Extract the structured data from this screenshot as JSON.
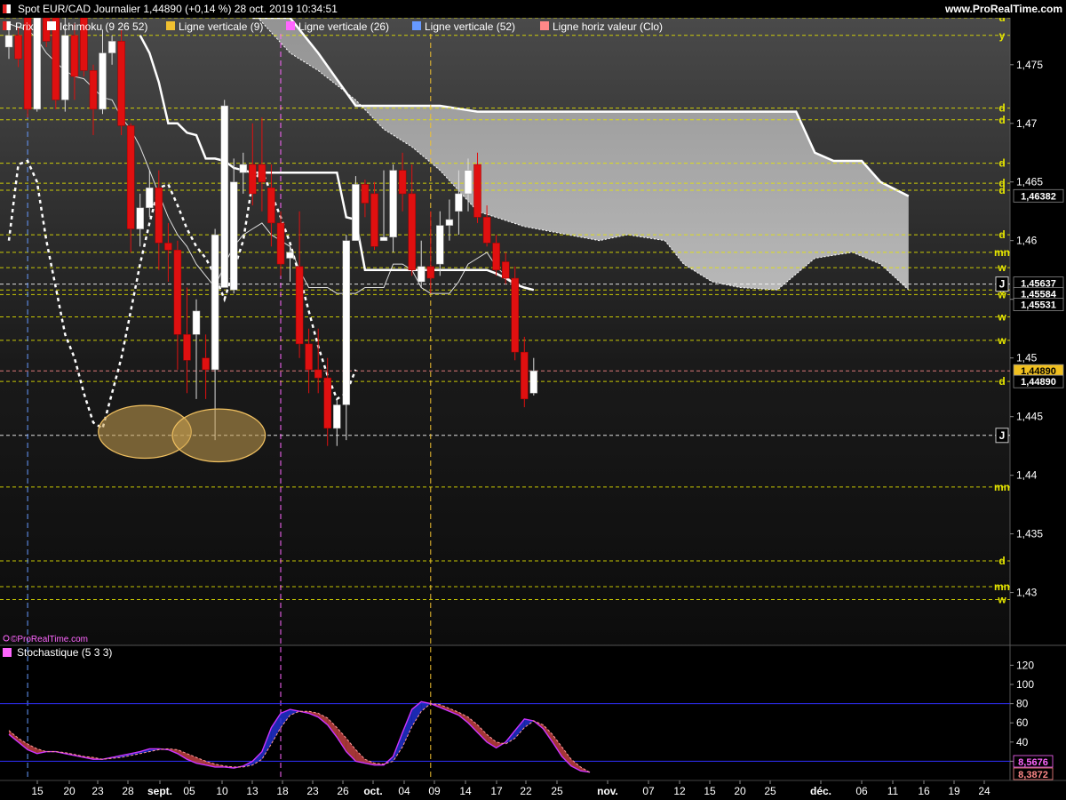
{
  "header": {
    "title": "Spot EUR/CAD Journalier 1,44890 (+0,14 %) 28 oct. 2019 10:34:51",
    "brand": "www.ProRealTime.com"
  },
  "legend": [
    {
      "label": "Prix",
      "color": "#ffffff"
    },
    {
      "label": "Ichimoku (9 26 52)",
      "color": "#ffffff"
    },
    {
      "label": "Ligne verticale (9)",
      "color": "#f0c030"
    },
    {
      "label": "Ligne verticale (26)",
      "color": "#ff66ff"
    },
    {
      "label": "Ligne verticale (52)",
      "color": "#6699ff"
    },
    {
      "label": "Ligne horiz valeur (Clo)",
      "color": "#ff8888"
    }
  ],
  "watermark": "©ProRealTime.com",
  "indicator": {
    "title": "Stochastique (5 3 3)",
    "ticks": [
      120,
      100,
      80,
      60,
      40,
      20
    ],
    "levels": [
      80,
      20
    ],
    "badge_k": "8,5676",
    "badge_d": "8,3872",
    "badge_k_color": "#ff66ff",
    "badge_d_color": "#ff8888"
  },
  "price_axis": {
    "ticks": [
      "1,475",
      "1,47",
      "1,465",
      "1,46",
      "1,455",
      "1,45",
      "1,445",
      "1,44",
      "1,435",
      "1,43"
    ],
    "badges": [
      {
        "text": "1,46382",
        "price": 1.46382,
        "bg": "#000000",
        "fg": "#ffffff"
      },
      {
        "text": "1,45637",
        "price": 1.45637,
        "bg": "#000000",
        "fg": "#ffffff"
      },
      {
        "text": "1,45584",
        "price": 1.45584,
        "bg": "#000000",
        "fg": "#ffffff"
      },
      {
        "text": "1,45531",
        "price": 1.45531,
        "bg": "#000000",
        "fg": "#ffffff"
      },
      {
        "text": "1,44890",
        "price": 1.4489,
        "bg": "#f0c020",
        "fg": "#000000"
      },
      {
        "text": "1,44890",
        "price": 1.4489,
        "bg": "#000000",
        "fg": "#ffffff"
      }
    ]
  },
  "x_axis_labels": [
    "15",
    "20",
    "23",
    "28",
    "sept.",
    "05",
    "10",
    "13",
    "18",
    "23",
    "26",
    "oct.",
    "04",
    "09",
    "14",
    "17",
    "22",
    "25",
    "nov.",
    "07",
    "12",
    "15",
    "20",
    "25",
    "déc.",
    "06",
    "11",
    "16",
    "19",
    "24"
  ],
  "chart_data": [
    {
      "type": "candlestick",
      "title": "Spot EUR/CAD Journalier",
      "ylim": [
        1.4255,
        1.479
      ],
      "candles": [
        {
          "o": 1.4765,
          "h": 1.4785,
          "l": 1.4755,
          "c": 1.4775
        },
        {
          "o": 1.4775,
          "h": 1.4782,
          "l": 1.4748,
          "c": 1.4755
        },
        {
          "o": 1.4795,
          "h": 1.48,
          "l": 1.4705,
          "c": 1.4712
        },
        {
          "o": 1.4712,
          "h": 1.479,
          "l": 1.471,
          "c": 1.479
        },
        {
          "o": 1.479,
          "h": 1.4795,
          "l": 1.4765,
          "c": 1.477
        },
        {
          "o": 1.479,
          "h": 1.4795,
          "l": 1.4712,
          "c": 1.472
        },
        {
          "o": 1.472,
          "h": 1.479,
          "l": 1.471,
          "c": 1.4775
        },
        {
          "o": 1.4775,
          "h": 1.4785,
          "l": 1.472,
          "c": 1.474
        },
        {
          "o": 1.4795,
          "h": 1.48,
          "l": 1.474,
          "c": 1.4745
        },
        {
          "o": 1.4745,
          "h": 1.475,
          "l": 1.469,
          "c": 1.4712
        },
        {
          "o": 1.4712,
          "h": 1.478,
          "l": 1.4708,
          "c": 1.476
        },
        {
          "o": 1.476,
          "h": 1.4775,
          "l": 1.475,
          "c": 1.477
        },
        {
          "o": 1.477,
          "h": 1.478,
          "l": 1.469,
          "c": 1.4698
        },
        {
          "o": 1.4698,
          "h": 1.47,
          "l": 1.459,
          "c": 1.461
        },
        {
          "o": 1.461,
          "h": 1.464,
          "l": 1.4595,
          "c": 1.4628
        },
        {
          "o": 1.4628,
          "h": 1.466,
          "l": 1.462,
          "c": 1.4645
        },
        {
          "o": 1.4645,
          "h": 1.466,
          "l": 1.4575,
          "c": 1.4598
        },
        {
          "o": 1.4598,
          "h": 1.4615,
          "l": 1.4565,
          "c": 1.4592
        },
        {
          "o": 1.4592,
          "h": 1.46,
          "l": 1.449,
          "c": 1.452
        },
        {
          "o": 1.452,
          "h": 1.456,
          "l": 1.447,
          "c": 1.4498
        },
        {
          "o": 1.452,
          "h": 1.455,
          "l": 1.4465,
          "c": 1.454
        },
        {
          "o": 1.45,
          "h": 1.452,
          "l": 1.4465,
          "c": 1.449
        },
        {
          "o": 1.449,
          "h": 1.461,
          "l": 1.443,
          "c": 1.4605
        },
        {
          "o": 1.456,
          "h": 1.472,
          "l": 1.456,
          "c": 1.4715
        },
        {
          "o": 1.4558,
          "h": 1.467,
          "l": 1.4555,
          "c": 1.465
        },
        {
          "o": 1.4658,
          "h": 1.4675,
          "l": 1.464,
          "c": 1.4665
        },
        {
          "o": 1.4665,
          "h": 1.47,
          "l": 1.463,
          "c": 1.464
        },
        {
          "o": 1.4665,
          "h": 1.4705,
          "l": 1.4625,
          "c": 1.465
        },
        {
          "o": 1.4645,
          "h": 1.4665,
          "l": 1.4595,
          "c": 1.4615
        },
        {
          "o": 1.4615,
          "h": 1.4625,
          "l": 1.457,
          "c": 1.458
        },
        {
          "o": 1.4585,
          "h": 1.4595,
          "l": 1.4565,
          "c": 1.459
        },
        {
          "o": 1.4578,
          "h": 1.4625,
          "l": 1.45,
          "c": 1.4512
        },
        {
          "o": 1.4512,
          "h": 1.4525,
          "l": 1.447,
          "c": 1.449
        },
        {
          "o": 1.449,
          "h": 1.4525,
          "l": 1.447,
          "c": 1.4483
        },
        {
          "o": 1.4483,
          "h": 1.45,
          "l": 1.4425,
          "c": 1.444
        },
        {
          "o": 1.444,
          "h": 1.4465,
          "l": 1.4425,
          "c": 1.446
        },
        {
          "o": 1.446,
          "h": 1.4605,
          "l": 1.443,
          "c": 1.46
        },
        {
          "o": 1.46,
          "h": 1.4655,
          "l": 1.46,
          "c": 1.4648
        },
        {
          "o": 1.4648,
          "h": 1.4652,
          "l": 1.462,
          "c": 1.4632
        },
        {
          "o": 1.464,
          "h": 1.465,
          "l": 1.4592,
          "c": 1.4595
        },
        {
          "o": 1.46,
          "h": 1.466,
          "l": 1.46,
          "c": 1.4603
        },
        {
          "o": 1.4603,
          "h": 1.4665,
          "l": 1.459,
          "c": 1.466
        },
        {
          "o": 1.466,
          "h": 1.4675,
          "l": 1.4625,
          "c": 1.464
        },
        {
          "o": 1.464,
          "h": 1.4665,
          "l": 1.457,
          "c": 1.4575
        },
        {
          "o": 1.4565,
          "h": 1.46,
          "l": 1.456,
          "c": 1.4578
        },
        {
          "o": 1.4578,
          "h": 1.4625,
          "l": 1.4555,
          "c": 1.4568
        },
        {
          "o": 1.458,
          "h": 1.4625,
          "l": 1.457,
          "c": 1.4613
        },
        {
          "o": 1.4613,
          "h": 1.4635,
          "l": 1.46,
          "c": 1.4618
        },
        {
          "o": 1.4625,
          "h": 1.466,
          "l": 1.4605,
          "c": 1.464
        },
        {
          "o": 1.464,
          "h": 1.467,
          "l": 1.4625,
          "c": 1.466
        },
        {
          "o": 1.4665,
          "h": 1.4675,
          "l": 1.4615,
          "c": 1.462
        },
        {
          "o": 1.462,
          "h": 1.463,
          "l": 1.4595,
          "c": 1.4598
        },
        {
          "o": 1.4598,
          "h": 1.4605,
          "l": 1.457,
          "c": 1.4575
        },
        {
          "o": 1.4582,
          "h": 1.459,
          "l": 1.4563,
          "c": 1.4568
        },
        {
          "o": 1.4568,
          "h": 1.4578,
          "l": 1.4498,
          "c": 1.4505
        },
        {
          "o": 1.4505,
          "h": 1.4518,
          "l": 1.4458,
          "c": 1.4465
        },
        {
          "o": 1.447,
          "h": 1.45,
          "l": 1.4468,
          "c": 1.4489
        }
      ],
      "tenkan": [
        1.4785,
        1.4782,
        1.478,
        1.4772,
        1.476,
        1.4752,
        1.4745,
        1.474,
        1.4738,
        1.473,
        1.4722,
        1.472,
        1.4705,
        1.4695,
        1.468,
        1.466,
        1.464,
        1.462,
        1.4605,
        1.4595,
        1.458,
        1.457,
        1.456,
        1.458,
        1.4595,
        1.4605,
        1.461,
        1.4615,
        1.4605,
        1.46,
        1.4595,
        1.4575,
        1.456,
        1.456,
        1.456,
        1.4555,
        1.4555,
        1.4555,
        1.456,
        1.456,
        1.456,
        1.458,
        1.458,
        1.4575,
        1.456,
        1.4555,
        1.4555,
        1.4555,
        1.4565,
        1.458,
        1.4585,
        1.459,
        1.4578,
        1.457,
        1.4563,
        1.456,
        1.4558
      ],
      "kijun": [
        null,
        null,
        null,
        null,
        null,
        null,
        null,
        null,
        null,
        null,
        null,
        null,
        null,
        null,
        1.4775,
        1.476,
        1.4735,
        1.47,
        1.47,
        1.4692,
        1.469,
        1.467,
        1.467,
        1.4668,
        1.4662,
        1.466,
        1.4658,
        1.4658,
        1.4658,
        1.4658,
        1.4658,
        1.4658,
        1.4658,
        1.4658,
        1.4658,
        1.4658,
        1.462,
        1.4618,
        1.4575,
        1.4575,
        1.4575,
        1.4575,
        1.4575,
        1.4575,
        1.4575,
        1.4575,
        1.4575,
        1.4575,
        1.4575,
        1.4575,
        1.4575,
        1.4575,
        1.4572,
        1.4568,
        1.4563,
        1.456,
        1.4558
      ],
      "chikou": [
        1.46,
        1.4665,
        1.4668,
        1.465,
        1.46,
        1.456,
        1.452,
        1.45,
        1.447,
        1.4445,
        1.444,
        1.447,
        1.45,
        1.454,
        1.458,
        1.4615,
        1.4645,
        1.4648,
        1.463,
        1.461,
        1.4595,
        1.4585,
        1.457,
        1.455,
        1.4575,
        1.46,
        1.465,
        1.466,
        1.464,
        1.462,
        1.4598,
        1.457,
        1.454,
        1.451,
        1.4485,
        1.4465,
        1.447,
        1.449
      ],
      "ssa": [
        {
          "i": 26,
          "v": 1.4795
        },
        {
          "i": 30,
          "v": 1.476
        },
        {
          "i": 33,
          "v": 1.4745
        },
        {
          "i": 37,
          "v": 1.472
        },
        {
          "i": 40,
          "v": 1.4695
        },
        {
          "i": 43,
          "v": 1.468
        },
        {
          "i": 46,
          "v": 1.466
        },
        {
          "i": 50,
          "v": 1.4625
        },
        {
          "i": 55,
          "v": 1.4612
        },
        {
          "i": 59,
          "v": 1.4606
        },
        {
          "i": 63,
          "v": 1.46
        },
        {
          "i": 66,
          "v": 1.4605
        },
        {
          "i": 70,
          "v": 1.46
        },
        {
          "i": 72,
          "v": 1.458
        },
        {
          "i": 75,
          "v": 1.4565
        },
        {
          "i": 78,
          "v": 1.456
        },
        {
          "i": 82,
          "v": 1.4558
        },
        {
          "i": 86,
          "v": 1.4585
        },
        {
          "i": 90,
          "v": 1.459
        },
        {
          "i": 93,
          "v": 1.458
        },
        {
          "i": 96,
          "v": 1.4558
        }
      ],
      "ssb": [
        {
          "i": 26,
          "v": 1.479
        },
        {
          "i": 30,
          "v": 1.479
        },
        {
          "i": 33,
          "v": 1.476
        },
        {
          "i": 37,
          "v": 1.4715
        },
        {
          "i": 40,
          "v": 1.4715
        },
        {
          "i": 43,
          "v": 1.4715
        },
        {
          "i": 46,
          "v": 1.4715
        },
        {
          "i": 50,
          "v": 1.471
        },
        {
          "i": 55,
          "v": 1.471
        },
        {
          "i": 59,
          "v": 1.471
        },
        {
          "i": 63,
          "v": 1.471
        },
        {
          "i": 66,
          "v": 1.471
        },
        {
          "i": 70,
          "v": 1.471
        },
        {
          "i": 73,
          "v": 1.471
        },
        {
          "i": 76,
          "v": 1.471
        },
        {
          "i": 80,
          "v": 1.471
        },
        {
          "i": 84,
          "v": 1.471
        },
        {
          "i": 86,
          "v": 1.4675
        },
        {
          "i": 88,
          "v": 1.4668
        },
        {
          "i": 91,
          "v": 1.4668
        },
        {
          "i": 93,
          "v": 1.465
        },
        {
          "i": 96,
          "v": 1.4638
        }
      ],
      "lagging_ichimoku_kumo_edge": [],
      "vlines": [
        {
          "i": 2,
          "color": "#6699ff"
        },
        {
          "i": 29,
          "color": "#ff66ff"
        },
        {
          "i": 45,
          "color": "#f0c030"
        }
      ],
      "hlines": [
        {
          "price": 1.479,
          "label": "d",
          "color": "#e6e600"
        },
        {
          "price": 1.4775,
          "label": "y",
          "color": "#e6e600"
        },
        {
          "price": 1.4713,
          "label": "d",
          "color": "#e6e600"
        },
        {
          "price": 1.4703,
          "label": "d",
          "color": "#e6e600"
        },
        {
          "price": 1.4666,
          "label": "d",
          "color": "#e6e600"
        },
        {
          "price": 1.4649,
          "label": "d",
          "color": "#e6e600"
        },
        {
          "price": 1.4643,
          "label": "d",
          "color": "#e6e600"
        },
        {
          "price": 1.4605,
          "label": "d",
          "color": "#e6e600"
        },
        {
          "price": 1.459,
          "label": "mn",
          "color": "#e6e600"
        },
        {
          "price": 1.4577,
          "label": "w",
          "color": "#e6e600"
        },
        {
          "price": 1.4563,
          "label": "",
          "color": "#ffffff"
        },
        {
          "price": 1.4558,
          "label": "k",
          "color": "#e6e600"
        },
        {
          "price": 1.4554,
          "label": "w",
          "color": "#e6e600"
        },
        {
          "price": 1.4535,
          "label": "w",
          "color": "#e6e600"
        },
        {
          "price": 1.4515,
          "label": "w",
          "color": "#e6e600"
        },
        {
          "price": 1.4489,
          "label": "",
          "color": "#ff8888"
        },
        {
          "price": 1.448,
          "label": "d",
          "color": "#e6e600"
        },
        {
          "price": 1.4434,
          "label": "J",
          "color": "#ffffff"
        },
        {
          "price": 1.439,
          "label": "mn",
          "color": "#e6e600"
        },
        {
          "price": 1.4327,
          "label": "d",
          "color": "#e6e600"
        },
        {
          "price": 1.4305,
          "label": "mn",
          "color": "#e6e600"
        },
        {
          "price": 1.4294,
          "label": "w",
          "color": "#e6e600"
        }
      ],
      "right_markers": [
        {
          "price": 1.4563,
          "label": "J"
        },
        {
          "price": 1.4434,
          "label": "J"
        }
      ],
      "ellipses": [
        {
          "center_i": 14.5,
          "center_price": 1.4437,
          "half_width_bars": 3.1,
          "half_height": 0.00225
        },
        {
          "center_i": 22.4,
          "center_price": 1.4434,
          "half_width_bars": 3.1,
          "half_height": 0.00225
        }
      ]
    },
    {
      "type": "line",
      "title": "Stochastique (5 3 3)",
      "ylim": [
        0,
        125
      ],
      "k": [
        48,
        40,
        32,
        28,
        30,
        30,
        28,
        26,
        24,
        22,
        22,
        24,
        26,
        28,
        30,
        33,
        33,
        32,
        28,
        22,
        18,
        16,
        14,
        14,
        13,
        15,
        20,
        30,
        55,
        70,
        74,
        72,
        70,
        66,
        58,
        45,
        30,
        20,
        18,
        16,
        16,
        25,
        50,
        74,
        82,
        80,
        76,
        72,
        68,
        60,
        50,
        40,
        34,
        40,
        52,
        64,
        62,
        54,
        40,
        25,
        15,
        10,
        8.6
      ],
      "d": [
        52,
        44,
        38,
        33,
        30,
        30,
        29,
        27,
        25,
        24,
        22,
        23,
        24,
        26,
        28,
        30,
        32,
        33,
        32,
        28,
        24,
        20,
        17,
        15,
        14,
        14,
        16,
        22,
        38,
        55,
        68,
        72,
        72,
        70,
        65,
        55,
        44,
        32,
        22,
        18,
        17,
        20,
        35,
        56,
        72,
        80,
        79,
        75,
        71,
        66,
        58,
        48,
        40,
        38,
        44,
        55,
        62,
        58,
        48,
        35,
        22,
        14,
        8.4
      ],
      "levels": [
        80,
        20
      ]
    }
  ]
}
